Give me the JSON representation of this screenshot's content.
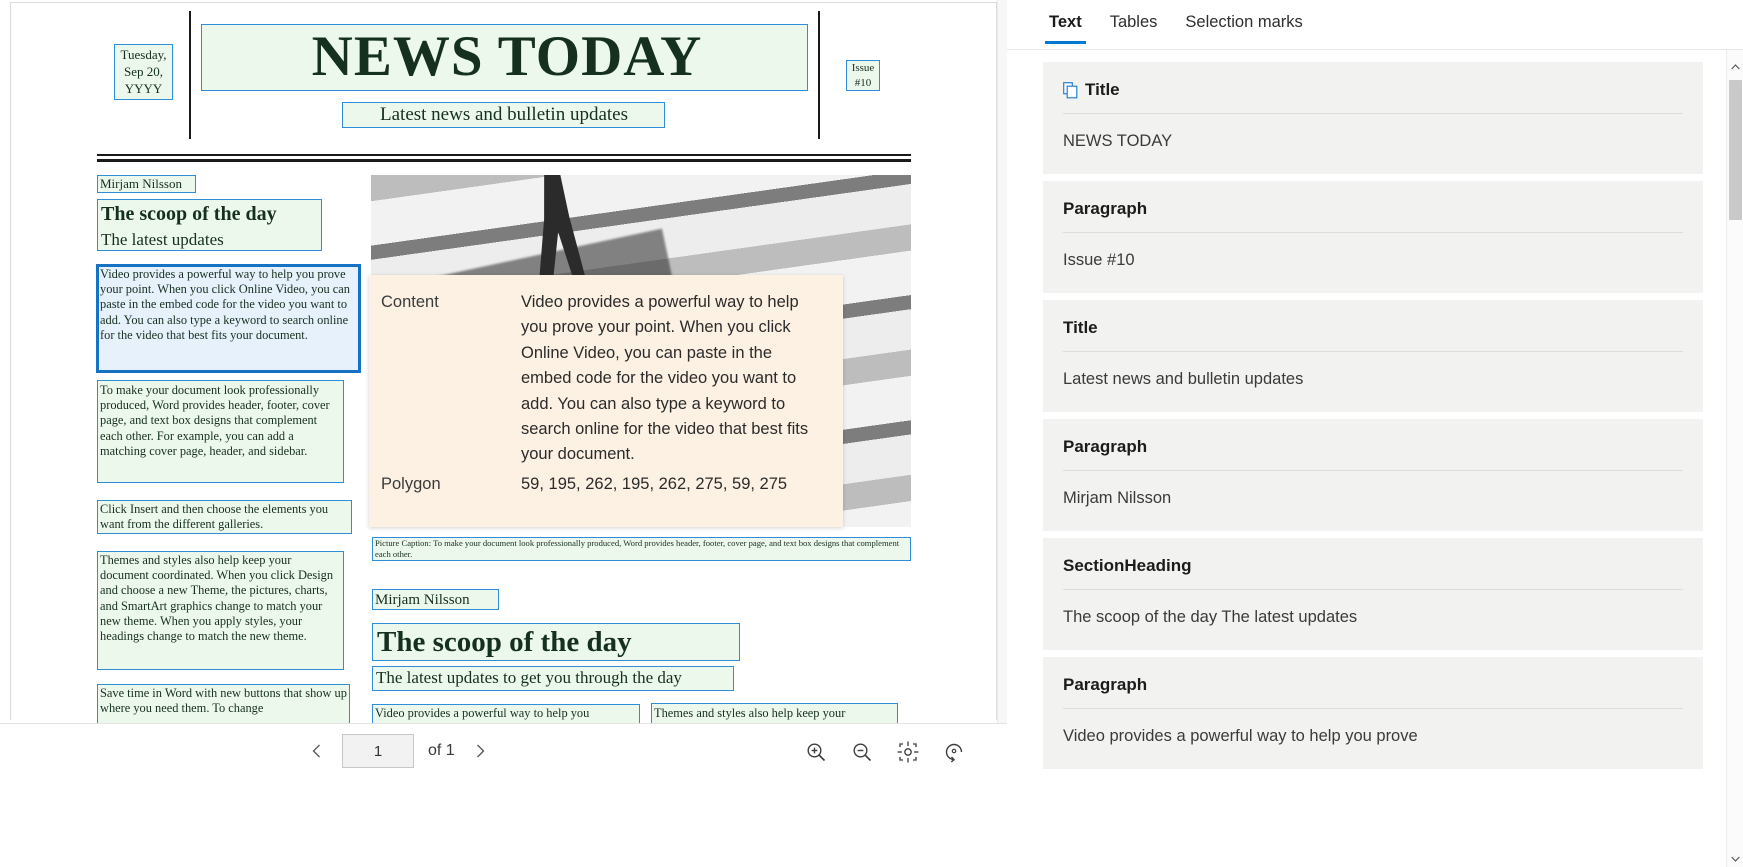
{
  "viewer": {
    "document": {
      "masthead": {
        "date": "Tuesday, Sep 20, YYYY",
        "title": "NEWS TODAY",
        "issue": "Issue #10",
        "subtitle": "Latest news and bulletin updates"
      },
      "left_column": {
        "byline": "Mirjam Nilsson",
        "heading": "The scoop of the day",
        "subheading": "The latest updates",
        "block1": "Video provides a powerful way to help you prove your point. When you click Online Video, you can paste in the embed code for the video you want to add. You can also type a keyword to search online for the video that best fits your document.",
        "block2": "To make your document look professionally produced, Word provides header, footer, cover page, and text box designs that complement each other. For example, you can add a matching cover page, header, and sidebar.",
        "block3": "Click Insert and then choose the elements you want from the different galleries.",
        "block4": "Themes and styles also help keep your document coordinated. When you click Design and choose a new Theme, the pictures, charts, and SmartArt graphics change to match your new theme. When you apply styles, your headings change to match the new theme.",
        "block5": "Save time in Word with new buttons that show up where you need them. To change"
      },
      "main_column": {
        "picture_caption": "Picture Caption: To make your document look professionally produced, Word provides header, footer, cover page, and text box designs that complement each other.",
        "byline": "Mirjam Nilsson",
        "heading": "The scoop of the day",
        "subheading": "The latest updates to get you through the day",
        "block1": "Video provides a powerful way to help you",
        "block2": "Themes and styles also help keep your"
      }
    },
    "tooltip": {
      "content_label": "Content",
      "content_value": "Video provides a powerful way to help you prove your point. When you click Online Video, you can paste in the embed code for the video you want to add. You can also type a keyword to search online for the video that best fits your document.",
      "polygon_label": "Polygon",
      "polygon_value": "59, 195, 262, 195, 262, 275, 59, 275"
    },
    "toolbar": {
      "previous_page": "previous-page",
      "next_page": "next-page",
      "page_number": "1",
      "of_label": "of 1",
      "zoom_in": "zoom-in",
      "zoom_out": "zoom-out",
      "fit_to_page": "fit-to-page",
      "rotate": "rotate"
    }
  },
  "panel": {
    "tabs": [
      {
        "label": "Text",
        "active": true
      },
      {
        "label": "Tables",
        "active": false
      },
      {
        "label": "Selection marks",
        "active": false
      }
    ],
    "results": [
      {
        "type": "Title",
        "value": "NEWS TODAY",
        "has_copy_icon": true
      },
      {
        "type": "Paragraph",
        "value": "Issue #10",
        "has_copy_icon": false
      },
      {
        "type": "Title",
        "value": "Latest news and bulletin updates",
        "has_copy_icon": false
      },
      {
        "type": "Paragraph",
        "value": "Mirjam Nilsson",
        "has_copy_icon": false
      },
      {
        "type": "SectionHeading",
        "value": "The scoop of the day The latest updates",
        "has_copy_icon": false
      },
      {
        "type": "Paragraph",
        "value": "Video provides a powerful way to help you prove",
        "has_copy_icon": false
      }
    ]
  },
  "colors": {
    "accent": "#0078d4",
    "ocr_box": "#2e8fd8",
    "ocr_box_selected": "#1673c4",
    "tooltip_bg": "#fcf1e3",
    "card_bg": "#f2f2f1"
  }
}
